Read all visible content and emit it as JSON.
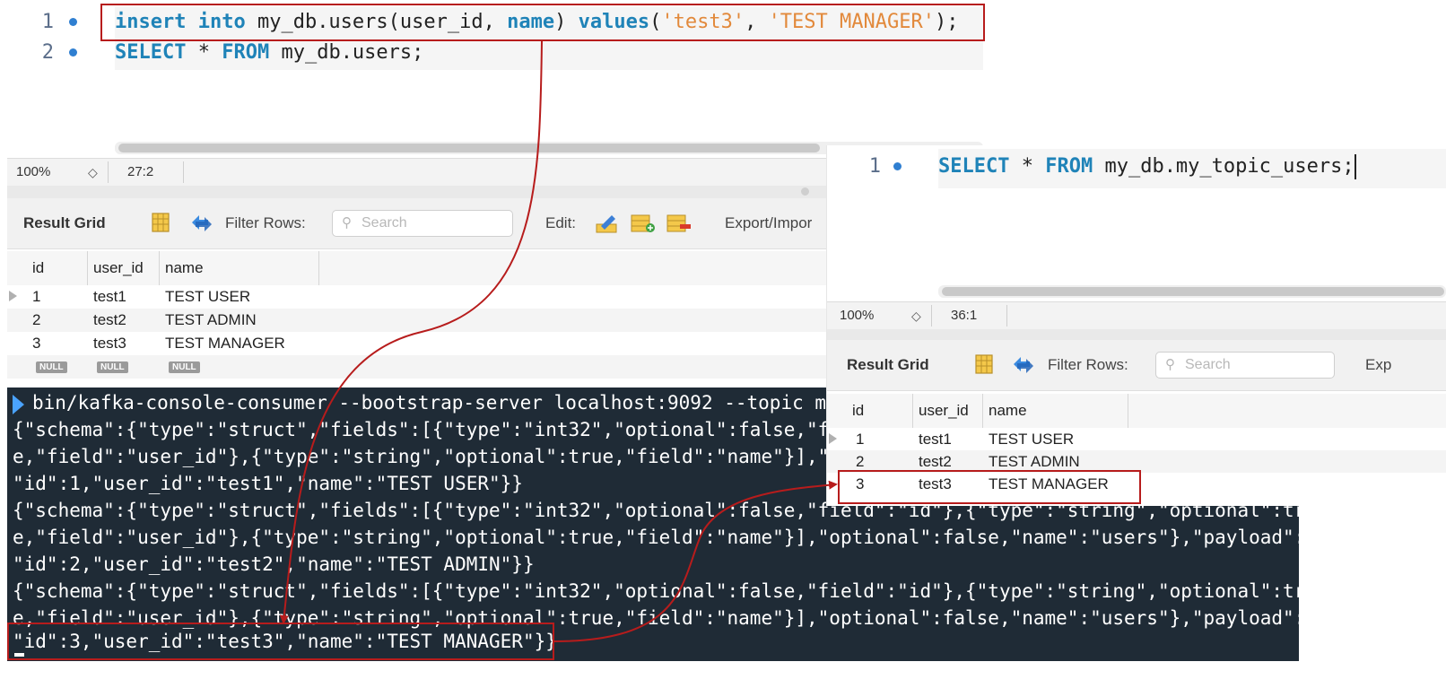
{
  "left_editor": {
    "lines": [
      {
        "num": "1",
        "parts": [
          {
            "t": "insert",
            "c": "kw"
          },
          {
            "t": " ",
            "c": ""
          },
          {
            "t": "into",
            "c": "kw"
          },
          {
            "t": " my_db.users(user_id, ",
            "c": ""
          },
          {
            "t": "name",
            "c": "kw"
          },
          {
            "t": ") ",
            "c": ""
          },
          {
            "t": "values",
            "c": "kw"
          },
          {
            "t": "(",
            "c": ""
          },
          {
            "t": "'test3'",
            "c": "str"
          },
          {
            "t": ", ",
            "c": ""
          },
          {
            "t": "'TEST MANAGER'",
            "c": "str"
          },
          {
            "t": ");",
            "c": ""
          }
        ]
      },
      {
        "num": "2",
        "parts": [
          {
            "t": "SELECT",
            "c": "kw"
          },
          {
            "t": " * ",
            "c": ""
          },
          {
            "t": "FROM",
            "c": "kw"
          },
          {
            "t": " my_db.users;",
            "c": ""
          }
        ]
      }
    ]
  },
  "left_status": {
    "zoom": "100%",
    "cursor": "27:2"
  },
  "left_toolbar": {
    "result_grid": "Result Grid",
    "filter_rows": "Filter Rows:",
    "search_placeholder": "Search",
    "edit": "Edit:",
    "export": "Export/Impor"
  },
  "left_grid": {
    "columns": [
      "id",
      "user_id",
      "name"
    ],
    "rows": [
      [
        "1",
        "test1",
        "TEST USER"
      ],
      [
        "2",
        "test2",
        "TEST ADMIN"
      ],
      [
        "3",
        "test3",
        "TEST MANAGER"
      ]
    ],
    "null_label": "NULL"
  },
  "right_editor": {
    "lines": [
      {
        "num": "1",
        "parts": [
          {
            "t": "SELECT",
            "c": "kw"
          },
          {
            "t": " * ",
            "c": ""
          },
          {
            "t": "FROM",
            "c": "kw"
          },
          {
            "t": " my_db.my_topic_users;",
            "c": ""
          }
        ]
      }
    ]
  },
  "right_status": {
    "zoom": "100%",
    "cursor": "36:1"
  },
  "right_toolbar": {
    "result_grid": "Result Grid",
    "filter_rows": "Filter Rows:",
    "search_placeholder": "Search",
    "export": "Exp"
  },
  "right_grid": {
    "columns": [
      "id",
      "user_id",
      "name"
    ],
    "rows": [
      [
        "1",
        "test1",
        "TEST USER"
      ],
      [
        "2",
        "test2",
        "TEST ADMIN"
      ],
      [
        "3",
        "test3",
        "TEST MANAGER"
      ]
    ]
  },
  "terminal": {
    "command": "bin/kafka-console-consumer --bootstrap-server localhost:9092 --topic my_",
    "lines": [
      "{\"schema\":{\"type\":\"struct\",\"fields\":[{\"type\":\"int32\",\"optional\":false,\"fie",
      "e,\"field\":\"user_id\"},{\"type\":\"string\",\"optional\":true,\"field\":\"name\"}],\"op",
      "\"id\":1,\"user_id\":\"test1\",\"name\":\"TEST USER\"}}",
      "{\"schema\":{\"type\":\"struct\",\"fields\":[{\"type\":\"int32\",\"optional\":false,\"field\":\"id\"},{\"type\":\"string\",\"optional\":tru",
      "e,\"field\":\"user_id\"},{\"type\":\"string\",\"optional\":true,\"field\":\"name\"}],\"optional\":false,\"name\":\"users\"},\"payload\":{",
      "\"id\":2,\"user_id\":\"test2\",\"name\":\"TEST ADMIN\"}}",
      "{\"schema\":{\"type\":\"struct\",\"fields\":[{\"type\":\"int32\",\"optional\":false,\"field\":\"id\"},{\"type\":\"string\",\"optional\":tru",
      "e,\"field\":\"user_id\"},{\"type\":\"string\",\"optional\":true,\"field\":\"name\"}],\"optional\":false,\"name\":\"users\"},\"payload\":{",
      "\"id\":3,\"user_id\":\"test3\",\"name\":\"TEST MANAGER\"}}"
    ]
  },
  "colors": {
    "highlight": "#b71c1c",
    "keyword": "#1f83b8",
    "string": "#e2893b",
    "terminal_bg": "#1f2b36"
  }
}
